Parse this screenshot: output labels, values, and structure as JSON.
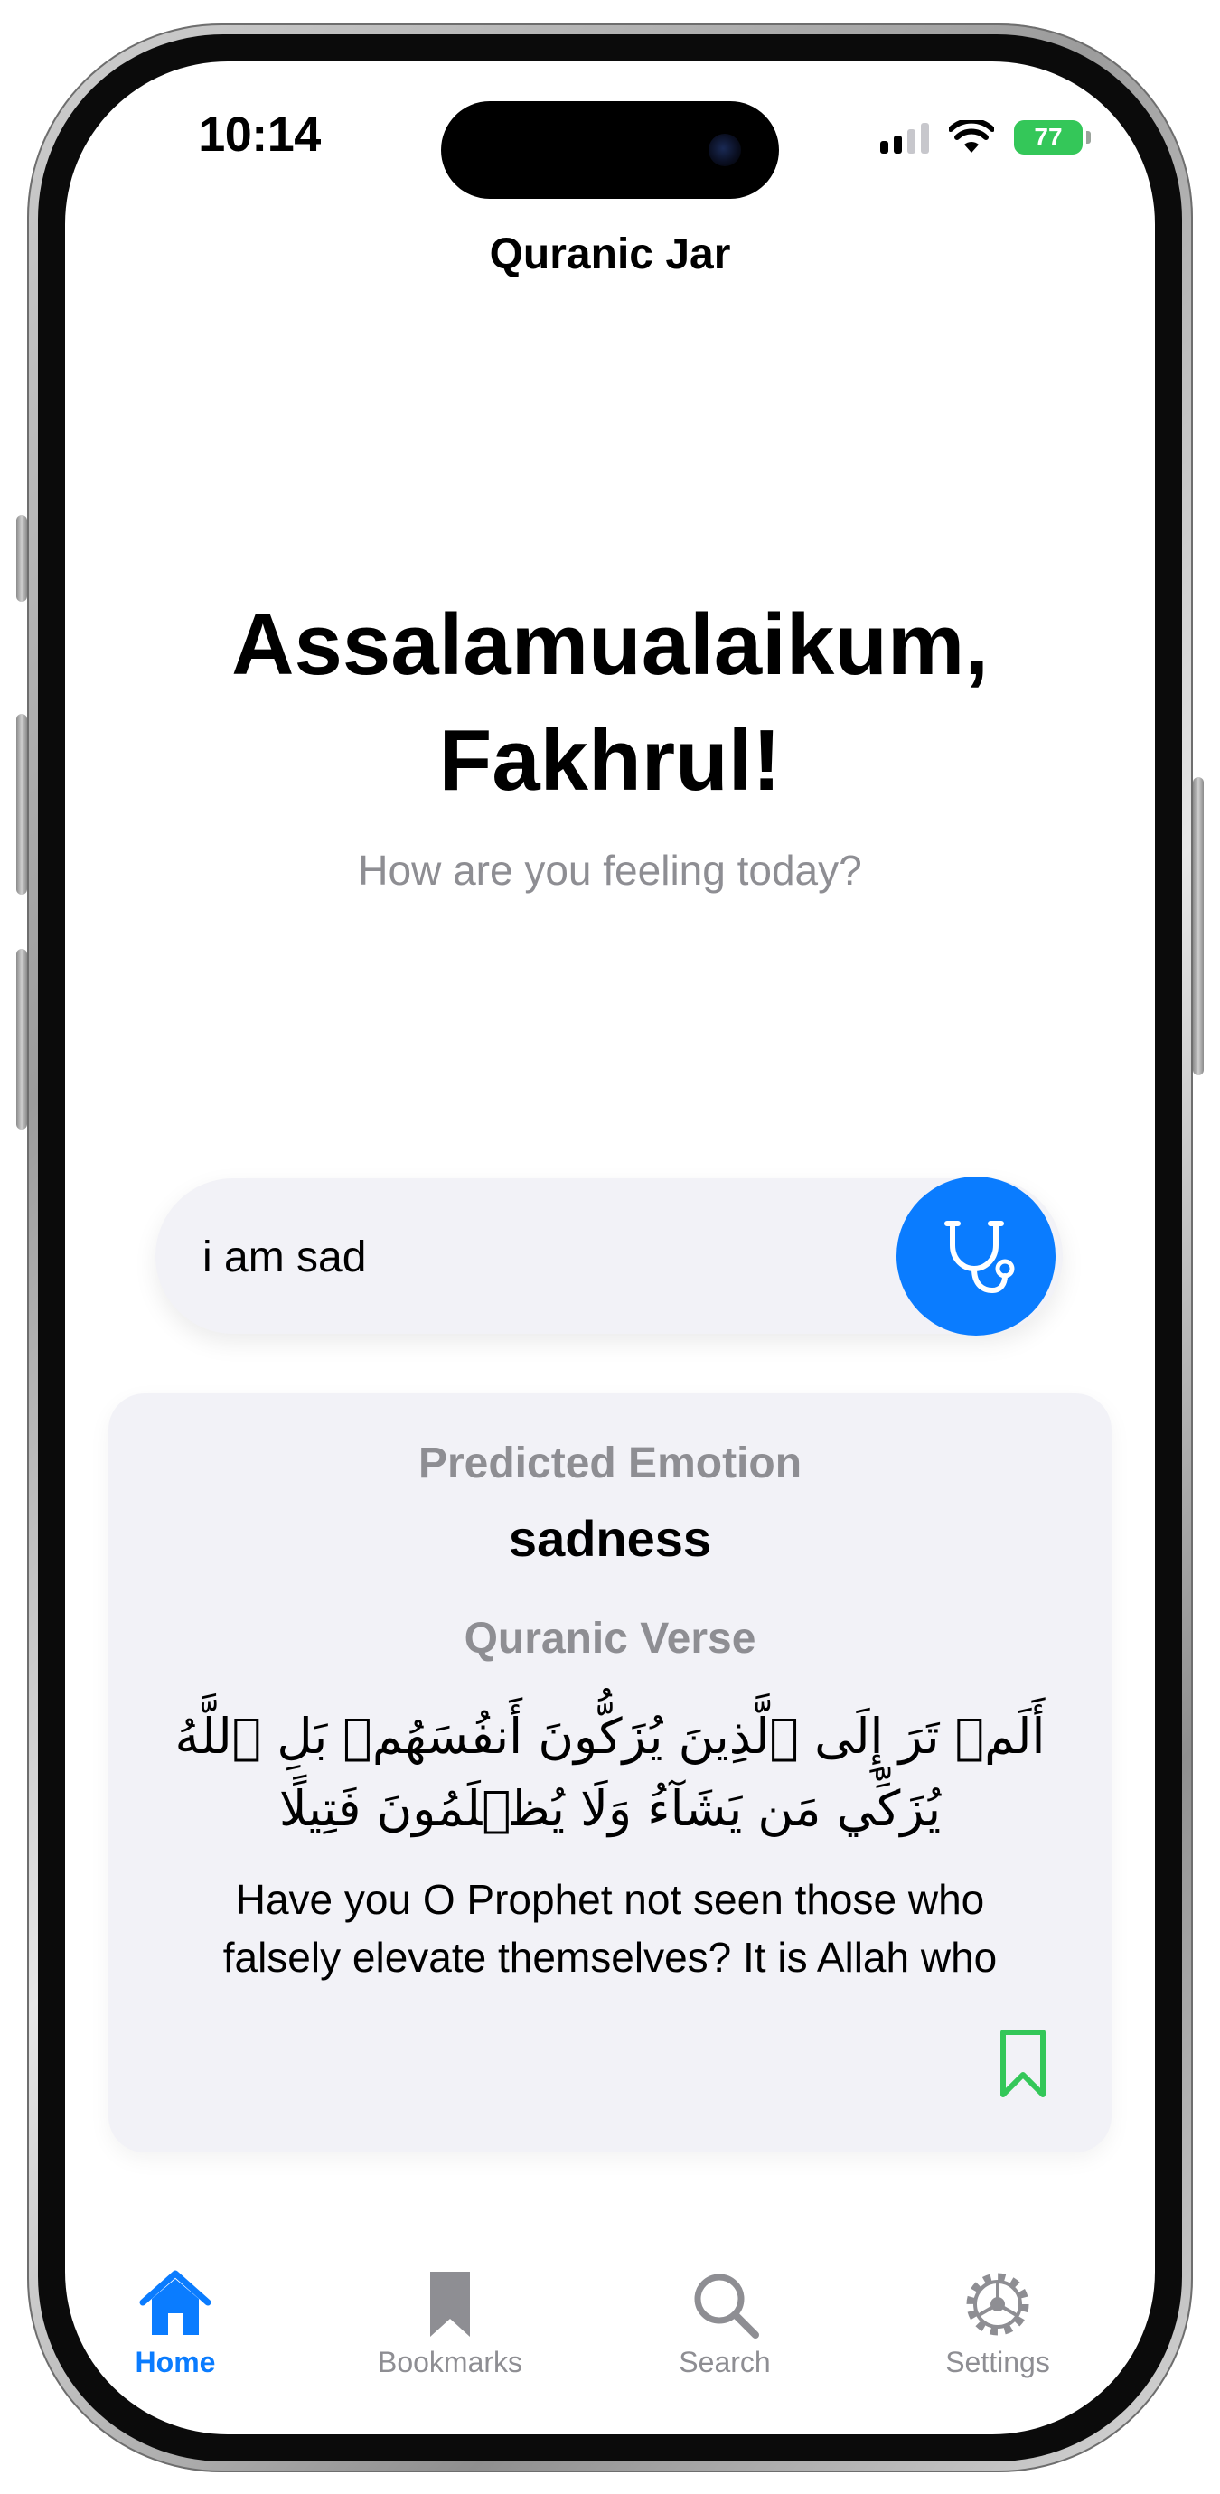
{
  "status_bar": {
    "time": "10:14",
    "battery_level": "77"
  },
  "app": {
    "title": "Quranic Jar"
  },
  "greeting": {
    "line1": "Assalamualaikum,",
    "line2": "Fakhrul!",
    "subtitle": "How are you feeling today?"
  },
  "input": {
    "value": "i am sad",
    "diagnose_icon": "stethoscope-icon"
  },
  "result": {
    "emotion_label": "Predicted Emotion",
    "emotion_value": "sadness",
    "verse_label": "Quranic Verse",
    "arabic_verse": "أَلَمۡ تَرَ إِلَى ٱلَّذِينَ يُزَكُّونَ أَنفُسَهُمۚ بَلِ ٱللَّهُ يُزَكِّي مَن يَشَآءُ وَلَا يُظۡلَمُونَ فَتِيلًا",
    "translation": "Have you O Prophet not seen those who falsely elevate themselves? It is Allah who",
    "bookmark_icon": "bookmark-icon"
  },
  "tab_bar": {
    "items": [
      {
        "label": "Home",
        "icon": "house-icon",
        "active": true
      },
      {
        "label": "Bookmarks",
        "icon": "bookmark-icon",
        "active": false
      },
      {
        "label": "Search",
        "icon": "magnifier-icon",
        "active": false
      },
      {
        "label": "Settings",
        "icon": "gear-icon",
        "active": false
      }
    ]
  },
  "colors": {
    "accent": "#0a7cff",
    "bookmark": "#34c759",
    "secondary_text": "#8e8e93",
    "card_background": "#f2f2f7"
  }
}
